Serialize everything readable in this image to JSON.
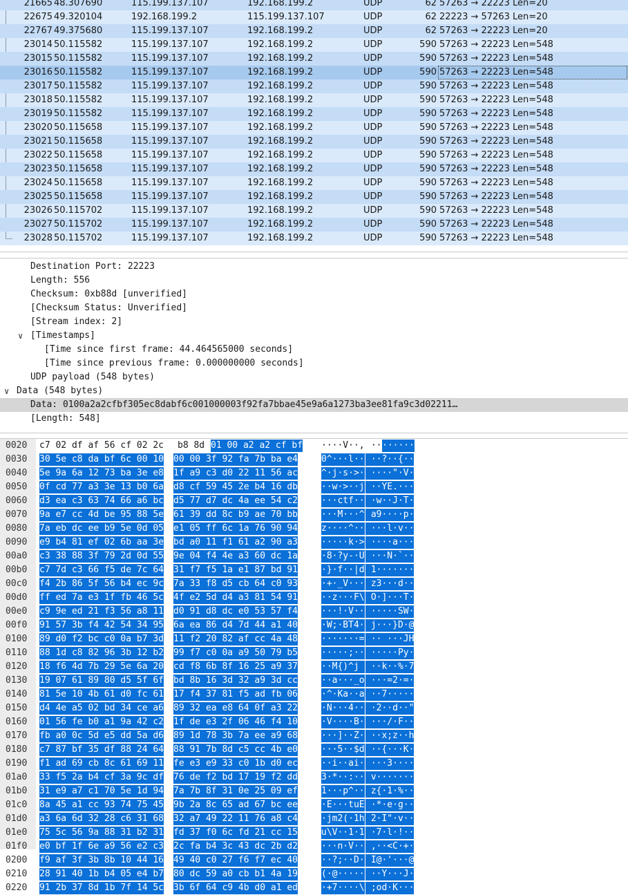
{
  "packet_list": {
    "rows": [
      {
        "no": "21665",
        "time": "48.307690",
        "src": "115.199.137.107",
        "dst": "192.168.199.2",
        "proto": "UDP",
        "len": "62",
        "info": "57263 → 22223 Len=20"
      },
      {
        "no": "22675",
        "time": "49.320104",
        "src": "192.168.199.2",
        "dst": "115.199.137.107",
        "proto": "UDP",
        "len": "62",
        "info": "22223 → 57263 Len=20"
      },
      {
        "no": "22767",
        "time": "49.375680",
        "src": "115.199.137.107",
        "dst": "192.168.199.2",
        "proto": "UDP",
        "len": "62",
        "info": "57263 → 22223 Len=20"
      },
      {
        "no": "23014",
        "time": "50.115582",
        "src": "115.199.137.107",
        "dst": "192.168.199.2",
        "proto": "UDP",
        "len": "590",
        "info": "57263 → 22223 Len=548"
      },
      {
        "no": "23015",
        "time": "50.115582",
        "src": "115.199.137.107",
        "dst": "192.168.199.2",
        "proto": "UDP",
        "len": "590",
        "info": "57263 → 22223 Len=548"
      },
      {
        "no": "23016",
        "time": "50.115582",
        "src": "115.199.137.107",
        "dst": "192.168.199.2",
        "proto": "UDP",
        "len": "590",
        "info": "57263 → 22223 Len=548"
      },
      {
        "no": "23017",
        "time": "50.115582",
        "src": "115.199.137.107",
        "dst": "192.168.199.2",
        "proto": "UDP",
        "len": "590",
        "info": "57263 → 22223 Len=548"
      },
      {
        "no": "23018",
        "time": "50.115582",
        "src": "115.199.137.107",
        "dst": "192.168.199.2",
        "proto": "UDP",
        "len": "590",
        "info": "57263 → 22223 Len=548"
      },
      {
        "no": "23019",
        "time": "50.115582",
        "src": "115.199.137.107",
        "dst": "192.168.199.2",
        "proto": "UDP",
        "len": "590",
        "info": "57263 → 22223 Len=548"
      },
      {
        "no": "23020",
        "time": "50.115658",
        "src": "115.199.137.107",
        "dst": "192.168.199.2",
        "proto": "UDP",
        "len": "590",
        "info": "57263 → 22223 Len=548"
      },
      {
        "no": "23021",
        "time": "50.115658",
        "src": "115.199.137.107",
        "dst": "192.168.199.2",
        "proto": "UDP",
        "len": "590",
        "info": "57263 → 22223 Len=548"
      },
      {
        "no": "23022",
        "time": "50.115658",
        "src": "115.199.137.107",
        "dst": "192.168.199.2",
        "proto": "UDP",
        "len": "590",
        "info": "57263 → 22223 Len=548"
      },
      {
        "no": "23023",
        "time": "50.115658",
        "src": "115.199.137.107",
        "dst": "192.168.199.2",
        "proto": "UDP",
        "len": "590",
        "info": "57263 → 22223 Len=548"
      },
      {
        "no": "23024",
        "time": "50.115658",
        "src": "115.199.137.107",
        "dst": "192.168.199.2",
        "proto": "UDP",
        "len": "590",
        "info": "57263 → 22223 Len=548"
      },
      {
        "no": "23025",
        "time": "50.115658",
        "src": "115.199.137.107",
        "dst": "192.168.199.2",
        "proto": "UDP",
        "len": "590",
        "info": "57263 → 22223 Len=548"
      },
      {
        "no": "23026",
        "time": "50.115702",
        "src": "115.199.137.107",
        "dst": "192.168.199.2",
        "proto": "UDP",
        "len": "590",
        "info": "57263 → 22223 Len=548"
      },
      {
        "no": "23027",
        "time": "50.115702",
        "src": "115.199.137.107",
        "dst": "192.168.199.2",
        "proto": "UDP",
        "len": "590",
        "info": "57263 → 22223 Len=548"
      },
      {
        "no": "23028",
        "time": "50.115702",
        "src": "115.199.137.107",
        "dst": "192.168.199.2",
        "proto": "UDP",
        "len": "590",
        "info": "57263 → 22223 Len=548"
      }
    ]
  },
  "details": {
    "rows": [
      {
        "text": "Destination Port: 22223",
        "indent": 2,
        "arrow": ""
      },
      {
        "text": "Length: 556",
        "indent": 2,
        "arrow": ""
      },
      {
        "text": "Checksum: 0xb88d [unverified]",
        "indent": 2,
        "arrow": ""
      },
      {
        "text": "[Checksum Status: Unverified]",
        "indent": 2,
        "arrow": ""
      },
      {
        "text": "[Stream index: 2]",
        "indent": 2,
        "arrow": ""
      },
      {
        "text": "[Timestamps]",
        "indent": 2,
        "arrow": "down"
      },
      {
        "text": "[Time since first frame: 44.464565000 seconds]",
        "indent": 3,
        "arrow": ""
      },
      {
        "text": "[Time since previous frame: 0.000000000 seconds]",
        "indent": 3,
        "arrow": ""
      },
      {
        "text": "UDP payload (548 bytes)",
        "indent": 2,
        "arrow": ""
      },
      {
        "text": "Data (548 bytes)",
        "indent": 1,
        "arrow": "down"
      },
      {
        "text": "Data: 0100a2a2cfbf305ec8dabf6c001000003f92fa7bbae45e9a6a1273ba3ee81fa9c3d02211…",
        "indent": 2,
        "arrow": "",
        "highlight": true
      },
      {
        "text": "[Length: 548]",
        "indent": 2,
        "arrow": ""
      }
    ]
  },
  "bytes": {
    "rows": [
      {
        "off": "0020",
        "h1": "c7 02 df af 56 cf 02 2c",
        "h2": "b8 8d",
        "h3": "01 00 a2 a2 cf bf",
        "a1": "····V··,",
        "a2": " ··",
        "a3": "······"
      },
      {
        "off": "0030",
        "h1": "30 5e c8 da bf 6c 00 10",
        "h2": "00 00 3f 92 fa 7b ba e4",
        "a1": "0^···l··",
        "a2": " ··?··{··"
      },
      {
        "off": "0040",
        "h1": "5e 9a 6a 12 73 ba 3e e8",
        "h2": "1f a9 c3 d0 22 11 56 ac",
        "a1": "^·j·s·>·",
        "a2": " ····\"·V·"
      },
      {
        "off": "0050",
        "h1": "0f cd 77 a3 3e 13 b0 6a",
        "h2": "d8 cf 59 45 2e b4 16 db",
        "a1": "··w·>··j",
        "a2": " ··YE.···"
      },
      {
        "off": "0060",
        "h1": "d3 ea c3 63 74 66 a6 bc",
        "h2": "d5 77 d7 dc 4a ee 54 c2",
        "a1": "···ctf··",
        "a2": " ·w··J·T·"
      },
      {
        "off": "0070",
        "h1": "9a e7 cc 4d be 95 88 5e",
        "h2": "61 39 dd 8c b9 ae 70 bb",
        "a1": "···M···^",
        "a2": " a9····p·"
      },
      {
        "off": "0080",
        "h1": "7a eb dc ee b9 5e 0d 05",
        "h2": "e1 05 ff 6c 1a 76 90 94",
        "a1": "z····^··",
        "a2": " ···l·v··"
      },
      {
        "off": "0090",
        "h1": "e9 b4 81 ef 02 6b aa 3e",
        "h2": "bd a0 11 f1 61 a2 90 a3",
        "a1": "·····k·>",
        "a2": " ····a···"
      },
      {
        "off": "00a0",
        "h1": "c3 38 88 3f 79 2d 0d 55",
        "h2": "9e 04 f4 4e a3 60 dc 1a",
        "a1": "·8·?y-·U",
        "a2": " ···N·`··"
      },
      {
        "off": "00b0",
        "h1": "c7 7d c3 66 f5 de 7c 64",
        "h2": "31 f7 f5 1a e1 87 bd 91",
        "a1": "·}·f··|d",
        "a2": " 1·······"
      },
      {
        "off": "00c0",
        "h1": "f4 2b 86 5f 56 b4 ec 9c",
        "h2": "7a 33 f8 d5 cb 64 c0 93",
        "a1": "·+·_V···",
        "a2": " z3···d··"
      },
      {
        "off": "00d0",
        "h1": "ff ed 7a e3 1f fb 46 5c",
        "h2": "4f e2 5d d4 a3 81 54 91",
        "a1": "··z···F\\",
        "a2": " O·]···T·"
      },
      {
        "off": "00e0",
        "h1": "c9 9e ed 21 f3 56 a8 11",
        "h2": "d0 91 d8 dc e0 53 57 f4",
        "a1": "···!·V··",
        "a2": " ·····SW·"
      },
      {
        "off": "00f0",
        "h1": "91 57 3b f4 42 54 34 95",
        "h2": "6a ea 86 d4 7d 44 a1 40",
        "a1": "·W;·BT4·",
        "a2": " j···}D·@"
      },
      {
        "off": "0100",
        "h1": "89 d0 f2 bc c0 0a b7 3d",
        "h2": "11 f2 20 82 af cc 4a 48",
        "a1": "·······=",
        "a2": " ·· ···JH"
      },
      {
        "off": "0110",
        "h1": "88 1d c8 82 96 3b 12 b2",
        "h2": "99 f7 c0 0a a9 50 79 b5",
        "a1": "·····;··",
        "a2": " ·····Py·"
      },
      {
        "off": "0120",
        "h1": "18 f6 4d 7b 29 5e 6a 20",
        "h2": "cd f8 6b 8f 16 25 a9 37",
        "a1": "··M{)^j ",
        "a2": " ··k··%·7"
      },
      {
        "off": "0130",
        "h1": "19 07 61 89 80 d5 5f 6f",
        "h2": "bd 8b 16 3d 32 a9 3d cc",
        "a1": "··a···_o",
        "a2": " ···=2·=·"
      },
      {
        "off": "0140",
        "h1": "81 5e 10 4b 61 d0 fc 61",
        "h2": "17 f4 37 81 f5 ad fb 06",
        "a1": "·^·Ka··a",
        "a2": " ··7·····"
      },
      {
        "off": "0150",
        "h1": "d4 4e a5 02 bd 34 ce a6",
        "h2": "89 32 ea e8 64 0f a3 22",
        "a1": "·N···4··",
        "a2": " ·2··d··\""
      },
      {
        "off": "0160",
        "h1": "01 56 fe b0 a1 9a 42 c2",
        "h2": "1f de e3 2f 06 46 f4 10",
        "a1": "·V····B·",
        "a2": " ···/·F··"
      },
      {
        "off": "0170",
        "h1": "fb a0 0c 5d e5 dd 5a d6",
        "h2": "89 1d 78 3b 7a ee a9 68",
        "a1": "···]··Z·",
        "a2": " ··x;z··h"
      },
      {
        "off": "0180",
        "h1": "c7 87 bf 35 df 88 24 64",
        "h2": "88 91 7b 8d c5 cc 4b e0",
        "a1": "···5··$d",
        "a2": " ··{···K·"
      },
      {
        "off": "0190",
        "h1": "f1 ad 69 cb 8c 61 69 11",
        "h2": "fe e3 e9 33 c0 1b d0 ec",
        "a1": "··i··ai·",
        "a2": " ···3····"
      },
      {
        "off": "01a0",
        "h1": "33 f5 2a b4 cf 3a 9c df",
        "h2": "76 de f2 bd 17 19 f2 dd",
        "a1": "3·*··:··",
        "a2": " v·······"
      },
      {
        "off": "01b0",
        "h1": "31 e9 a7 c1 70 5e 1d 94",
        "h2": "7a 7b 8f 31 0e 25 09 ef",
        "a1": "1···p^··",
        "a2": " z{·1·%··"
      },
      {
        "off": "01c0",
        "h1": "8a 45 a1 cc 93 74 75 45",
        "h2": "9b 2a 8c 65 ad 67 bc ee",
        "a1": "·E···tuE",
        "a2": " ·*·e·g··"
      },
      {
        "off": "01d0",
        "h1": "a3 6a 6d 32 28 c6 31 68",
        "h2": "32 a7 49 22 11 76 a8 c4",
        "a1": "·jm2(·1h",
        "a2": " 2·I\"·v··"
      },
      {
        "off": "01e0",
        "h1": "75 5c 56 9a 88 31 b2 31",
        "h2": "fd 37 f0 6c fd 21 cc 15",
        "a1": "u\\V··1·1",
        "a2": " ·7·l·!··"
      },
      {
        "off": "01f0",
        "h1": "e0 bf 1f 6e a9 56 e2 c3",
        "h2": "2c fa b4 3c 43 dc 2b d2",
        "a1": "···n·V··",
        "a2": " ,··<C·+·"
      },
      {
        "off": "0200",
        "h1": "f9 af 3f 3b 8b 10 44 16",
        "h2": "49 40 c0 27 f6 f7 ec 40",
        "a1": "··?;··D·",
        "a2": " I@·'···@"
      },
      {
        "off": "0210",
        "h1": "28 91 40 1b b4 05 e4 b7",
        "h2": "80 dc 59 a0 cb b1 4a 19",
        "a1": "(·@·····",
        "a2": " ··Y···J·"
      },
      {
        "off": "0220",
        "h1": "91 2b 37 8d 1b 7f 14 5c",
        "h2": "3b 6f 64 c9 4b d0 a1 ed",
        "a1": "·+7····\\",
        "a2": " ;od·K···"
      }
    ]
  }
}
